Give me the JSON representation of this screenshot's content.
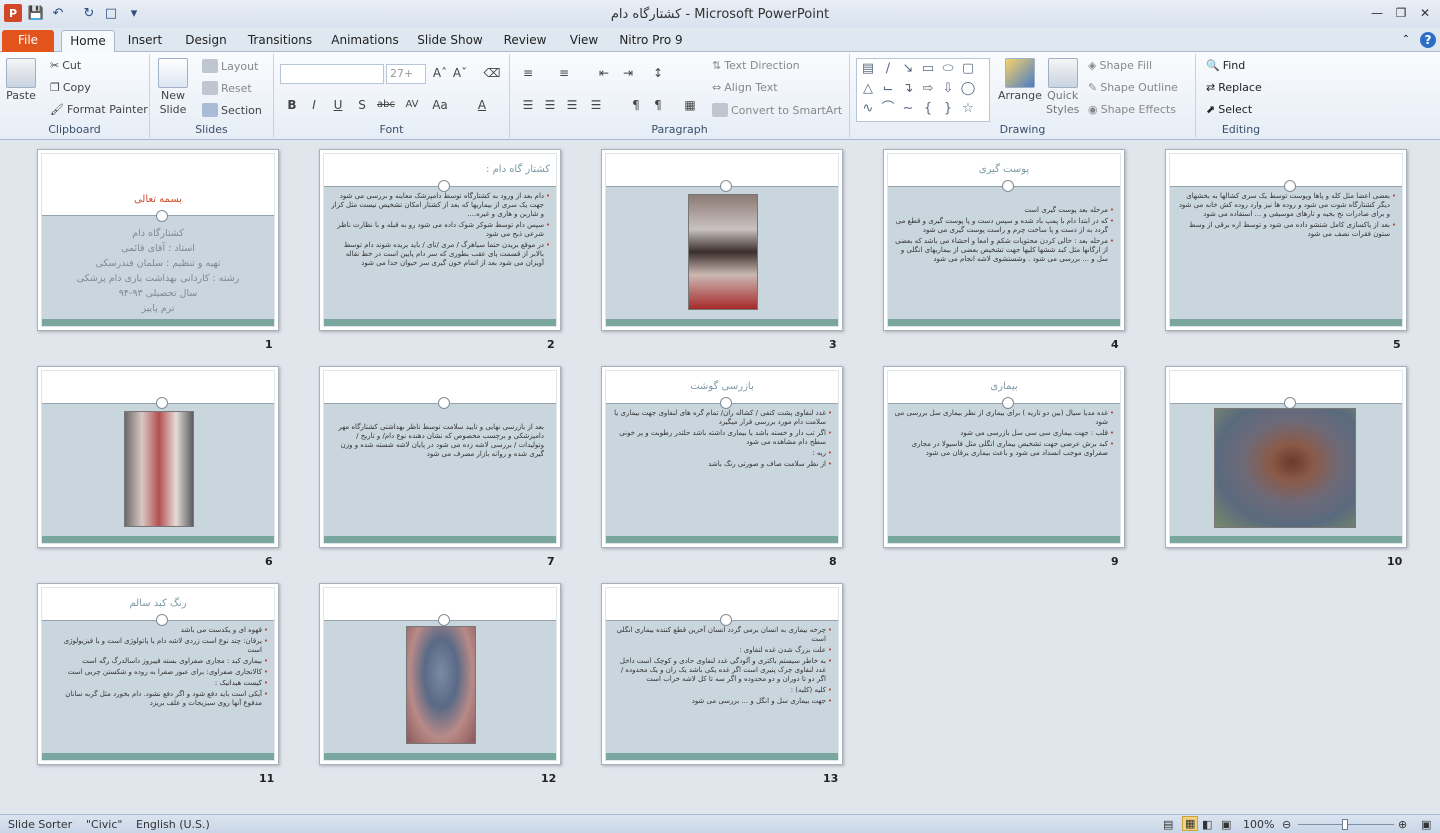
{
  "window": {
    "title": "کشتارگاه دام  -  Microsoft PowerPoint",
    "app_icon": "P",
    "qat_icons": [
      "save-icon",
      "undo-icon",
      "redo-icon",
      "new-file-icon",
      "customize-qat-icon"
    ]
  },
  "tabs": [
    "File",
    "Home",
    "Insert",
    "Design",
    "Transitions",
    "Animations",
    "Slide Show",
    "Review",
    "View",
    "Nitro Pro 9"
  ],
  "ribbon": {
    "clipboard": {
      "label": "Clipboard",
      "paste": "Paste",
      "cut": "Cut",
      "copy": "Copy",
      "format_painter": "Format Painter"
    },
    "slides": {
      "label": "Slides",
      "new_slide_1": "New",
      "new_slide_2": "Slide",
      "layout": "Layout",
      "reset": "Reset",
      "section": "Section"
    },
    "font": {
      "label": "Font",
      "font_name": "",
      "font_size": "27+",
      "bold": "B",
      "italic": "I",
      "underline": "U",
      "shadow": "S",
      "strike": "abc",
      "spacing": "AV",
      "case": "Aa",
      "color": "A"
    },
    "paragraph": {
      "label": "Paragraph",
      "text_direction": "Text Direction",
      "align_text": "Align Text",
      "convert": "Convert to SmartArt"
    },
    "drawing": {
      "label": "Drawing",
      "arrange_1": "Arrange",
      "quick_1": "Quick",
      "quick_2": "Styles",
      "shape_fill": "Shape Fill",
      "shape_outline": "Shape Outline",
      "shape_effects": "Shape Effects"
    },
    "editing": {
      "label": "Editing",
      "find": "Find",
      "replace": "Replace",
      "select": "Select"
    }
  },
  "slides": [
    {
      "num": "1",
      "title": "بسمه تعالی",
      "lines": [
        "کشتارگاه دام",
        "استاد : آقای قائمی",
        "تهیه و تنظیم : سلمان فندرسکی",
        "رشته : کاردانی بهداشت یاری دام پزشکی",
        "سال تحصیلی ۹۳-۹۴",
        "ترم پاییز"
      ]
    },
    {
      "num": "2",
      "title": "کشتار گاه دام :",
      "bullets": [
        "دام بعد از ورود به کشتارگاه توسط دامپزشک معاینه و بررسی می شود جهت یک سری از بیماریها که بعد از کشتار امکان تشخیص نیست مثل کزاز و شاربن و هاری و غیره....",
        "سپس دام توسط شوکر شوک داده می شود رو به قبله و با نظارت ناظر شرعی ذبح می شود",
        "در موقع بریدن حتما سیاهرگ / مری /نای / باید بریده شوند دام توسط بالابر از قسمت پای عقب بطوری که سر دام پایین است در خط نقاله آویزان می شود بعد از اتمام خون گیری سر حیوان جدا می شود"
      ]
    },
    {
      "num": "3",
      "title": ""
    },
    {
      "num": "4",
      "title": "پوست گیری",
      "bullets": [
        "مرحله بعد پوست گیری است",
        "که در ابتدا دام با پمپ باد شده و سپس دست و پا پوست گیری و قطع می گردد به از دست و پا ساخت چرم و راست پوست گیری می شود",
        "مرحله بعد : خالی کردن محتویات شکم و امعا و احشاء می باشد که بعضی از ارگانها مثل کبد ششها کلیها جهت تشخیص بعضی از بیماریهای انگلی و سل و ... بررسی می شود . وشستشوی لاشه انجام می شود"
      ]
    },
    {
      "num": "5",
      "title": "",
      "bullets": [
        "بعضی اعضا مثل کله و پاها وپوست توسط یک سری کشالها به بخشهای دیگر کشتارگاه شوت می شود و روده ها نیز وارد روده کش خانه می شود و برای صادرات نخ بخیه و تارهای موسیقی و ... استفاده می شود",
        "بعد از پاکسازی کامل شتشو داده می شود و توسط اره برقی از وسط ستون فقرات نصف می شود"
      ]
    },
    {
      "num": "6",
      "title": ""
    },
    {
      "num": "7",
      "title": "",
      "bullets": [
        "بعد از بازرسی نهایی و تایید سلامت توسط ناظر بهداشتی کشتارگاه مهر دامپزشکی و برچسب مخصوص که نشان دهنده نوع دام/ و تاریخ / وتولیدات / بررسی لاشه زده می شود در پایان لاشه شسته شده و وزن گیری شده و روانه بازار مصرف می شود"
      ]
    },
    {
      "num": "8",
      "title": "بازرسی گوشت",
      "bullets": [
        "غدد لنفاوی پشت کتفی / کشاله ران/ تمام گره های لنفاوی جهت بیماری یا سلامت دام مورد بررسی قرار میگیرد",
        "اگر تب دار و خسته باشد یا بیماری داشته باشد حلتدر رطوبت و پر خونی سطح دام مشاهده می شود",
        "ریه :",
        "از نظر سلامت صاف و صورتی رنگ باشد"
      ]
    },
    {
      "num": "9",
      "title": "بیماری",
      "bullets": [
        "غده مدیا سیال (بین دو تاریه ) برای بیماری از نظر بیماری سل بررسی می شود",
        "قلب : جهت بیماری سی سی سل بازرسی می شود",
        "کبد برش عرضی جهت تشخیص بیماری انگلی مثل فاسیولا در مجاری صفراوی موجب انسداد می شود و باعث بیماری یرقان می شود"
      ]
    },
    {
      "num": "10",
      "title": ""
    },
    {
      "num": "11",
      "title": "رنگ کبد سالم",
      "bullets": [
        "قهوه ای و یکدست می باشد",
        "یرقان: چند نوع است زردی لاشه دام یا پاتولوژی است و یا فیزیولوژی است",
        "بیماری کبد : مجاری صفراوی بسته فیبروز داسالدرگ رگه است",
        "کالانجاری صفراوی: برای عبور صفرا به روده و شکستن چربی است",
        "کیست هیداتیک :",
        "آبکی است باید دفع شود و اگر دفع نشود. دام بخورد مثل گربه سانان مدفوع آنها روی سبزیجات و علف بریزد"
      ]
    },
    {
      "num": "12",
      "title": ""
    },
    {
      "num": "13",
      "title": "",
      "bullets": [
        "چرخه بیماری به انسان برمی گردد انسان آخرین قطع کننده بیماری انگلی است",
        "علت بزرگ شدن غده لنفاوی :",
        "به خاطر سیستم باکتری و آلودگی غدد لنفاوی حادی و کوچک است داخل غدد لنفاوی چرک پنیری است اگر غده یکی باشد یک ران و یک محدوده / اگر دو تا دوران و دو محدوده و اگر سه تا کل لاشه خراب است",
        "کلیه (کلیه) :",
        "جهت بیماری سل و انگل و ... بررسی می شود"
      ]
    }
  ],
  "status": {
    "view": "Slide Sorter",
    "theme": "\"Civic\"",
    "language": "English (U.S.)",
    "zoom": "100%"
  }
}
